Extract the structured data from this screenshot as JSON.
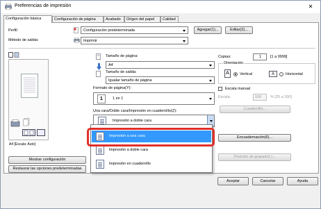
{
  "window": {
    "title": "Preferencias de impresión",
    "close_glyph": "✕"
  },
  "tabs": [
    {
      "label": "Configuración básica",
      "active": true
    },
    {
      "label": "Configuración de página"
    },
    {
      "label": "Acabado"
    },
    {
      "label": "Origen del papel"
    },
    {
      "label": "Calidad"
    }
  ],
  "profile": {
    "label": "Perfil:",
    "value": "Configuración predeterminada",
    "add_button": "Agregar(1)...",
    "edit_button": "Editar(2)..."
  },
  "output_method": {
    "label": "Método de salida:",
    "value": "Imprimir"
  },
  "preview": {
    "caption": "A4 [Escala: Auto]",
    "show_config_button": "Mostrar configuración",
    "restore_button": "Restaurar las opciones predeterminadas"
  },
  "page_size": {
    "label": "Tamaño de página:",
    "value": "A4"
  },
  "output_size": {
    "label": "Tamaño de salida:",
    "value": "Igualar tamaño de página"
  },
  "page_layout": {
    "label": "Formato de página(Y):",
    "number": "1",
    "value": "1 en 1"
  },
  "duplex": {
    "label": "Una cara/Doble cara/Impresión en cuadernillo(Z):",
    "value": "Impresión a doble cara",
    "options": [
      {
        "label": "Impresión a una cara",
        "selected": true
      },
      {
        "label": "Impresión a doble cara"
      },
      {
        "label": "Impresión en cuadernillo"
      }
    ]
  },
  "copies": {
    "label": "Copias:",
    "value": "1",
    "range": "[1 a 9999]"
  },
  "orientation": {
    "label": "Orientación",
    "portrait": "Vertical",
    "landscape": "Horizontal",
    "selected": "portrait"
  },
  "manual_scale": {
    "label": "Escala manual",
    "checked": false,
    "scale_label": "Escala:",
    "scale_value": "100",
    "scale_range": "% [25 a 200]"
  },
  "buttons": {
    "booklet": "Cuadernillo...",
    "binding": "Encuadernación(6)...",
    "staple_position": "Posición de grapado(-)...",
    "accept": "Aceptar",
    "cancel": "Cancelar",
    "help": "Ayuda"
  },
  "colors": {
    "highlight": "#3399ff",
    "focus_ring": "#e0302a"
  }
}
